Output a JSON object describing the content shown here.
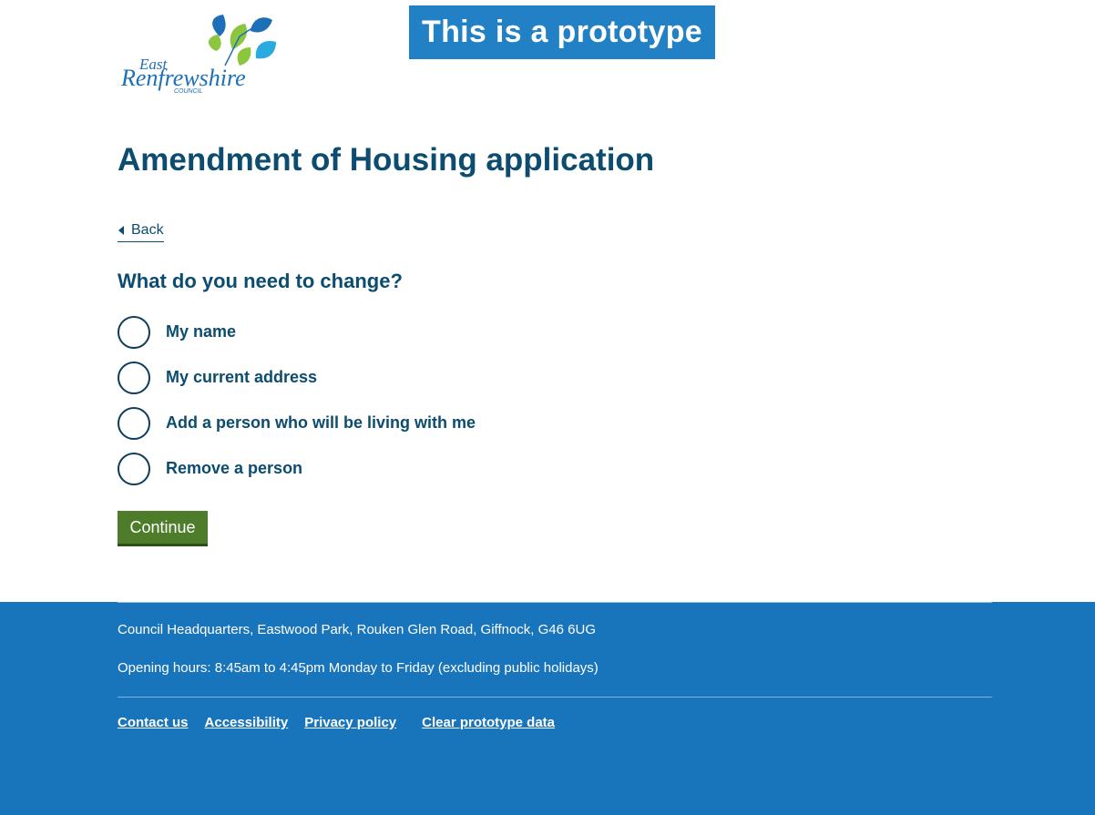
{
  "header": {
    "logo": {
      "line1": "East",
      "line2": "Renfrewshire",
      "line3": "COUNCIL",
      "icon": "leaf-logo-icon",
      "colors": {
        "blue": "#1d6fb8",
        "green": "#8cc63f",
        "lightblue": "#29abe2"
      }
    },
    "prototype_banner": "This is a prototype"
  },
  "main": {
    "title": "Amendment of Housing application",
    "back_label": "Back",
    "question": "What do you need to change?",
    "options": [
      {
        "label": "My name",
        "selected": false
      },
      {
        "label": "My current address",
        "selected": false
      },
      {
        "label": "Add a person who will be living with me",
        "selected": false
      },
      {
        "label": "Remove a person",
        "selected": false
      }
    ],
    "continue_label": "Continue"
  },
  "footer": {
    "address": "Council Headquarters, Eastwood Park, Rouken Glen Road, Giffnock, G46 6UG",
    "hours": "Opening hours: 8:45am to 4:45pm Monday to Friday (excluding public holidays)",
    "links": [
      "Contact us",
      "Accessibility",
      "Privacy policy",
      "Clear prototype data"
    ]
  },
  "colors": {
    "primary_text": "#0b4c6f",
    "banner": "#2280c4",
    "button": "#4d7d2a",
    "footer_bg": "#1874bb"
  }
}
